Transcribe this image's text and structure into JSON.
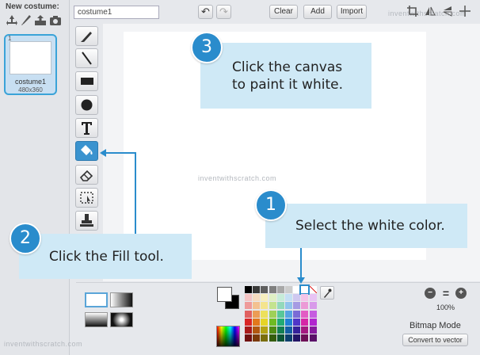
{
  "left_panel": {
    "new_costume_label": "New costume:",
    "costume": {
      "number": "1",
      "name": "costume1",
      "size": "480x360"
    }
  },
  "toolbar": {
    "name_value": "costume1",
    "undo_glyph": "↶",
    "redo_glyph": "↷",
    "clear_label": "Clear",
    "add_label": "Add",
    "import_label": "Import"
  },
  "tools": [
    "brush-tool",
    "line-tool",
    "rectangle-tool",
    "ellipse-tool",
    "text-tool",
    "fill-tool",
    "eraser-tool",
    "select-tool",
    "stamp-tool"
  ],
  "callouts": {
    "step1": {
      "number": "1",
      "text": "Select the white color."
    },
    "step2": {
      "number": "2",
      "text": "Click the Fill tool."
    },
    "step3": {
      "number": "3",
      "text": "Click the canvas\nto paint it white."
    }
  },
  "bottom": {
    "zoom_level": "100%",
    "mode_label": "Bitmap Mode",
    "convert_label": "Convert to vector"
  },
  "watermark": "inventwithscratch.com",
  "colors": {
    "accent": "#2a8ccc",
    "callout_bg": "#cfe9f6",
    "arrow": "#2a8ccc"
  },
  "palette": [
    [
      "#000000",
      "#3a3a3a",
      "#5e5e5e",
      "#7f7f7f",
      "#a8a8a8",
      "#cccccc",
      "#ffffff"
    ],
    [
      "#f4c4c4",
      "#f6dcc0",
      "#f7efbf",
      "#dff0c4",
      "#c6ecd9",
      "#c4dff4",
      "#cfc8f0"
    ],
    [
      "#ee9a9a",
      "#f3c190",
      "#f4e48e",
      "#c4e38f",
      "#93d9bb",
      "#92c4ec",
      "#a69be3"
    ],
    [
      "#e06060",
      "#ec9c55",
      "#ede05c",
      "#9fd058",
      "#58c799",
      "#56a3e2",
      "#7a6bd6"
    ],
    [
      "#d92626",
      "#e2781c",
      "#e6d426",
      "#6fbb22",
      "#22ab74",
      "#2080d4",
      "#5036c8"
    ],
    [
      "#a81a1a",
      "#b25810",
      "#b4a314",
      "#4f8c14",
      "#147f52",
      "#145fa3",
      "#36219a"
    ],
    [
      "#701010",
      "#7b3a08",
      "#7a6e0c",
      "#345d0c",
      "#0c5535",
      "#0c3f6d",
      "#231466"
    ]
  ],
  "palette_right": [
    [
      "#ffffff",
      "#e8e8e8"
    ],
    [
      "#f4c4e8",
      "#e8c4f4"
    ],
    [
      "#ec9ad6",
      "#d89aea"
    ],
    [
      "#e25cc4",
      "#c65ce0"
    ],
    [
      "#d626a6",
      "#b126cf"
    ],
    [
      "#a51a80",
      "#871a9e"
    ],
    [
      "#6e1056",
      "#5a1068"
    ]
  ]
}
